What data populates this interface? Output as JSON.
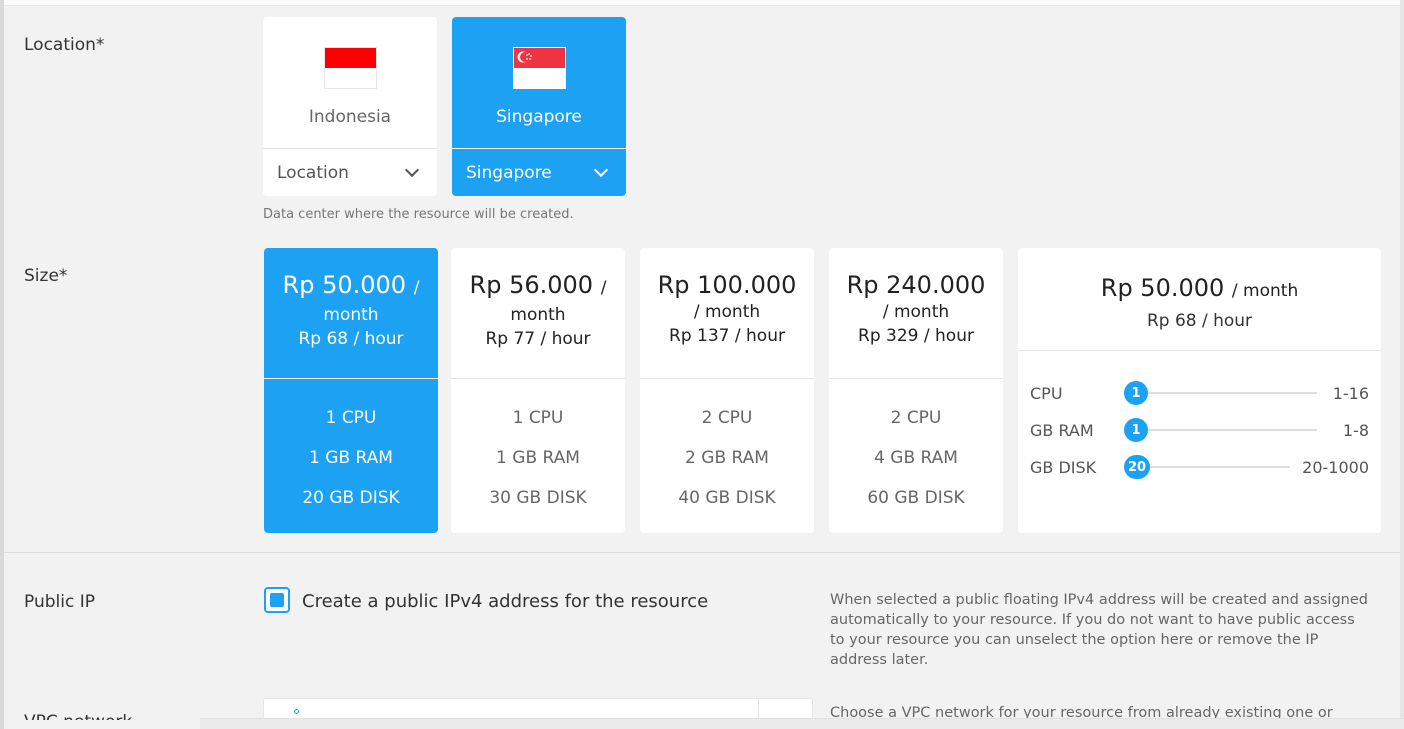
{
  "location": {
    "label": "Location*",
    "hint": "Data center where the resource will be created.",
    "cards": [
      {
        "name": "Indonesia",
        "dropdown": "Location",
        "selected": false,
        "flag_top": "#ff0000"
      },
      {
        "name": "Singapore",
        "dropdown": "Singapore",
        "selected": true,
        "flag_top": "#ef3340"
      }
    ]
  },
  "size": {
    "label": "Size*",
    "plans": [
      {
        "price_main": "Rp 50.000",
        "price_suffix": "/",
        "price_month": "month",
        "hour": "Rp 68 / hour",
        "cpu": "1 CPU",
        "ram": "1 GB RAM",
        "disk": "20 GB DISK",
        "selected": true
      },
      {
        "price_main": "Rp 56.000",
        "price_suffix": "/",
        "price_month": "month",
        "hour": "Rp 77 / hour",
        "cpu": "1 CPU",
        "ram": "1 GB RAM",
        "disk": "30 GB DISK",
        "selected": false
      },
      {
        "price_main": "Rp 100.000",
        "price_suffix": "",
        "price_month": "/ month",
        "hour": "Rp 137 / hour",
        "cpu": "2 CPU",
        "ram": "2 GB RAM",
        "disk": "40 GB DISK",
        "selected": false
      },
      {
        "price_main": "Rp 240.000",
        "price_suffix": "",
        "price_month": "/ month",
        "hour": "Rp 329 / hour",
        "cpu": "2 CPU",
        "ram": "4 GB RAM",
        "disk": "60 GB DISK",
        "selected": false
      }
    ],
    "custom": {
      "price_main": "Rp 50.000",
      "price_suffix": "/ month",
      "hour": "Rp 68 / hour",
      "sliders": [
        {
          "label": "CPU",
          "value": "1",
          "range": "1-16"
        },
        {
          "label": "GB RAM",
          "value": "1",
          "range": "1-8"
        },
        {
          "label": "GB DISK",
          "value": "20",
          "range": "20-1000"
        }
      ]
    }
  },
  "public_ip": {
    "label": "Public IP",
    "checkbox_label": "Create a public IPv4 address for the resource",
    "checked": true,
    "help": "When selected a public floating IPv4 address will be created and assigned automatically to your resource. If you do not want to have public access to your resource you can unselect the option here or remove the IP address later."
  },
  "vpc": {
    "label": "VPC network",
    "help": "Choose a VPC network for your resource from already existing one or"
  },
  "colors": {
    "accent": "#1da1f2",
    "background": "#f2f2f2",
    "card": "#ffffff"
  }
}
